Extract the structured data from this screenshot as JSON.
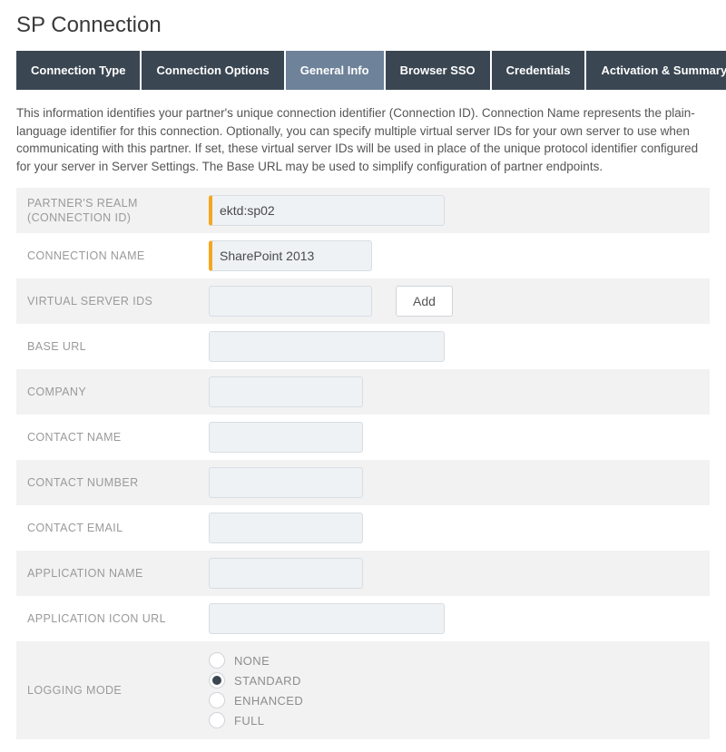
{
  "page": {
    "title": "SP Connection"
  },
  "tabs": [
    {
      "label": "Connection Type",
      "active": false
    },
    {
      "label": "Connection Options",
      "active": false
    },
    {
      "label": "General Info",
      "active": true
    },
    {
      "label": "Browser SSO",
      "active": false
    },
    {
      "label": "Credentials",
      "active": false
    },
    {
      "label": "Activation & Summary",
      "active": false
    }
  ],
  "intro": "This information identifies your partner's unique connection identifier (Connection ID). Connection Name represents the plain-language identifier for this connection. Optionally, you can specify multiple virtual server IDs for your own server to use when communicating with this partner. If set, these virtual server IDs will be used in place of the unique protocol identifier configured for your server in Server Settings. The Base URL may be used to simplify configuration of partner endpoints.",
  "form": {
    "partners_realm": {
      "label": "PARTNER'S REALM (CONNECTION ID)",
      "value": "ektd:sp02"
    },
    "connection_name": {
      "label": "CONNECTION NAME",
      "value": "SharePoint 2013"
    },
    "virtual_server_ids": {
      "label": "VIRTUAL SERVER IDS",
      "value": "",
      "add_button": "Add"
    },
    "base_url": {
      "label": "BASE URL",
      "value": ""
    },
    "company": {
      "label": "COMPANY",
      "value": ""
    },
    "contact_name": {
      "label": "CONTACT NAME",
      "value": ""
    },
    "contact_number": {
      "label": "CONTACT NUMBER",
      "value": ""
    },
    "contact_email": {
      "label": "CONTACT EMAIL",
      "value": ""
    },
    "application_name": {
      "label": "APPLICATION NAME",
      "value": ""
    },
    "application_icon_url": {
      "label": "APPLICATION ICON URL",
      "value": ""
    },
    "logging_mode": {
      "label": "LOGGING MODE",
      "options": [
        "NONE",
        "STANDARD",
        "ENHANCED",
        "FULL"
      ],
      "selected": "STANDARD"
    }
  }
}
